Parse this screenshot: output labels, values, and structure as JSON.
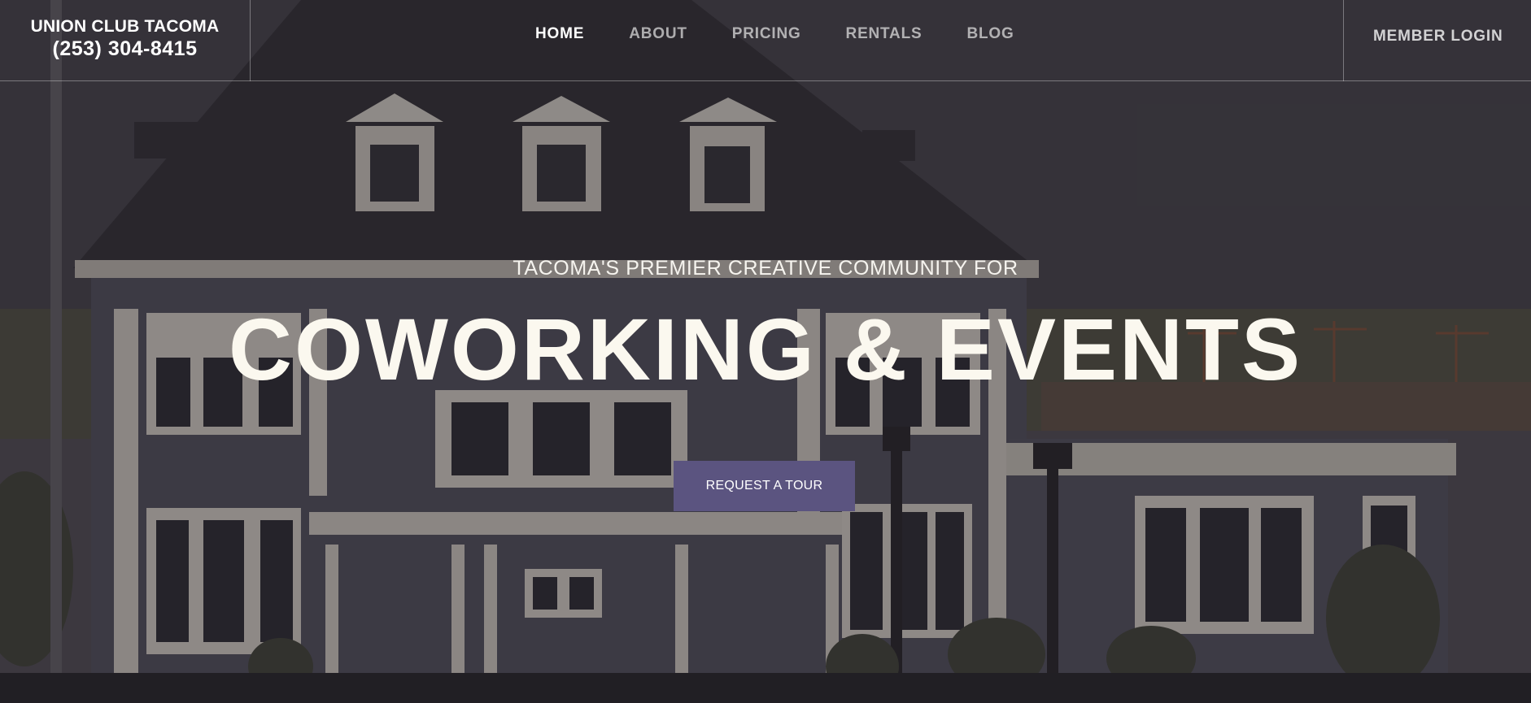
{
  "header": {
    "brand_name": "UNION CLUB TACOMA",
    "phone": "(253) 304-8415",
    "nav": [
      {
        "label": "HOME",
        "active": true
      },
      {
        "label": "ABOUT",
        "active": false
      },
      {
        "label": "PRICING",
        "active": false
      },
      {
        "label": "RENTALS",
        "active": false
      },
      {
        "label": "BLOG",
        "active": false
      }
    ],
    "login_label": "MEMBER LOGIN"
  },
  "hero": {
    "tagline": "TACOMA'S PREMIER CREATIVE COMMUNITY FOR",
    "headline": "COWORKING & EVENTS",
    "cta_label": "REQUEST A TOUR",
    "background": "photo of a large historic house with a dark hipped roof, dormer windows and white trim, bare trees in front and port cranes in the distance"
  },
  "colors": {
    "cta_bg": "#5b5480",
    "overlay": "#282428",
    "text_light": "#fbf8ef"
  }
}
